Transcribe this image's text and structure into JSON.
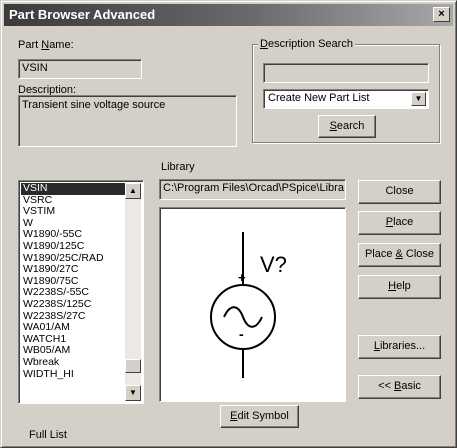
{
  "window": {
    "title": "Part Browser Advanced",
    "close_glyph": "×"
  },
  "part_name": {
    "label_prefix": "Part ",
    "label_accel": "N",
    "label_suffix": "ame:",
    "value": "VSIN"
  },
  "description": {
    "label": "Description:",
    "value": "Transient sine voltage source"
  },
  "description_search": {
    "title_accel": "D",
    "title_rest": "escription Search",
    "input_value": "",
    "dropdown_value": "Create New Part List",
    "search_accel": "S",
    "search_rest": "earch"
  },
  "library": {
    "label": "Library",
    "path": "C:\\Program Files\\Orcad\\PSpice\\Libra"
  },
  "parts_list": {
    "selected_index": 0,
    "items": [
      "VSIN",
      "VSRC",
      "VSTIM",
      "W",
      "W1890/-55C",
      "W1890/125C",
      "W1890/25C/RAD",
      "W1890/27C",
      "W1890/75C",
      "W2238S/-55C",
      "W2238S/125C",
      "W2238S/27C",
      "WA01/AM",
      "WATCH1",
      "WB05/AM",
      "Wbreak",
      "WIDTH_HI"
    ]
  },
  "buttons": {
    "close": "Close",
    "place": {
      "accel": "P",
      "rest": "lace"
    },
    "place_close": {
      "pre": "Place ",
      "accel": "&",
      "rest": " Close"
    },
    "help": {
      "accel": "H",
      "rest": "elp"
    },
    "libraries": {
      "accel": "L",
      "rest": "ibraries..."
    },
    "basic": {
      "pre": "<< ",
      "accel": "B",
      "rest": "asic"
    },
    "edit_symbol": {
      "accel": "E",
      "rest": "dit Symbol"
    }
  },
  "symbol_preview": {
    "ref_label": "V?",
    "plus": "+",
    "minus": "-"
  },
  "status": {
    "text": "Full List"
  },
  "scrollbar": {
    "up_icon": "▲",
    "down_icon": "▼",
    "position": 0.92
  },
  "dropdown_icon": "▼"
}
